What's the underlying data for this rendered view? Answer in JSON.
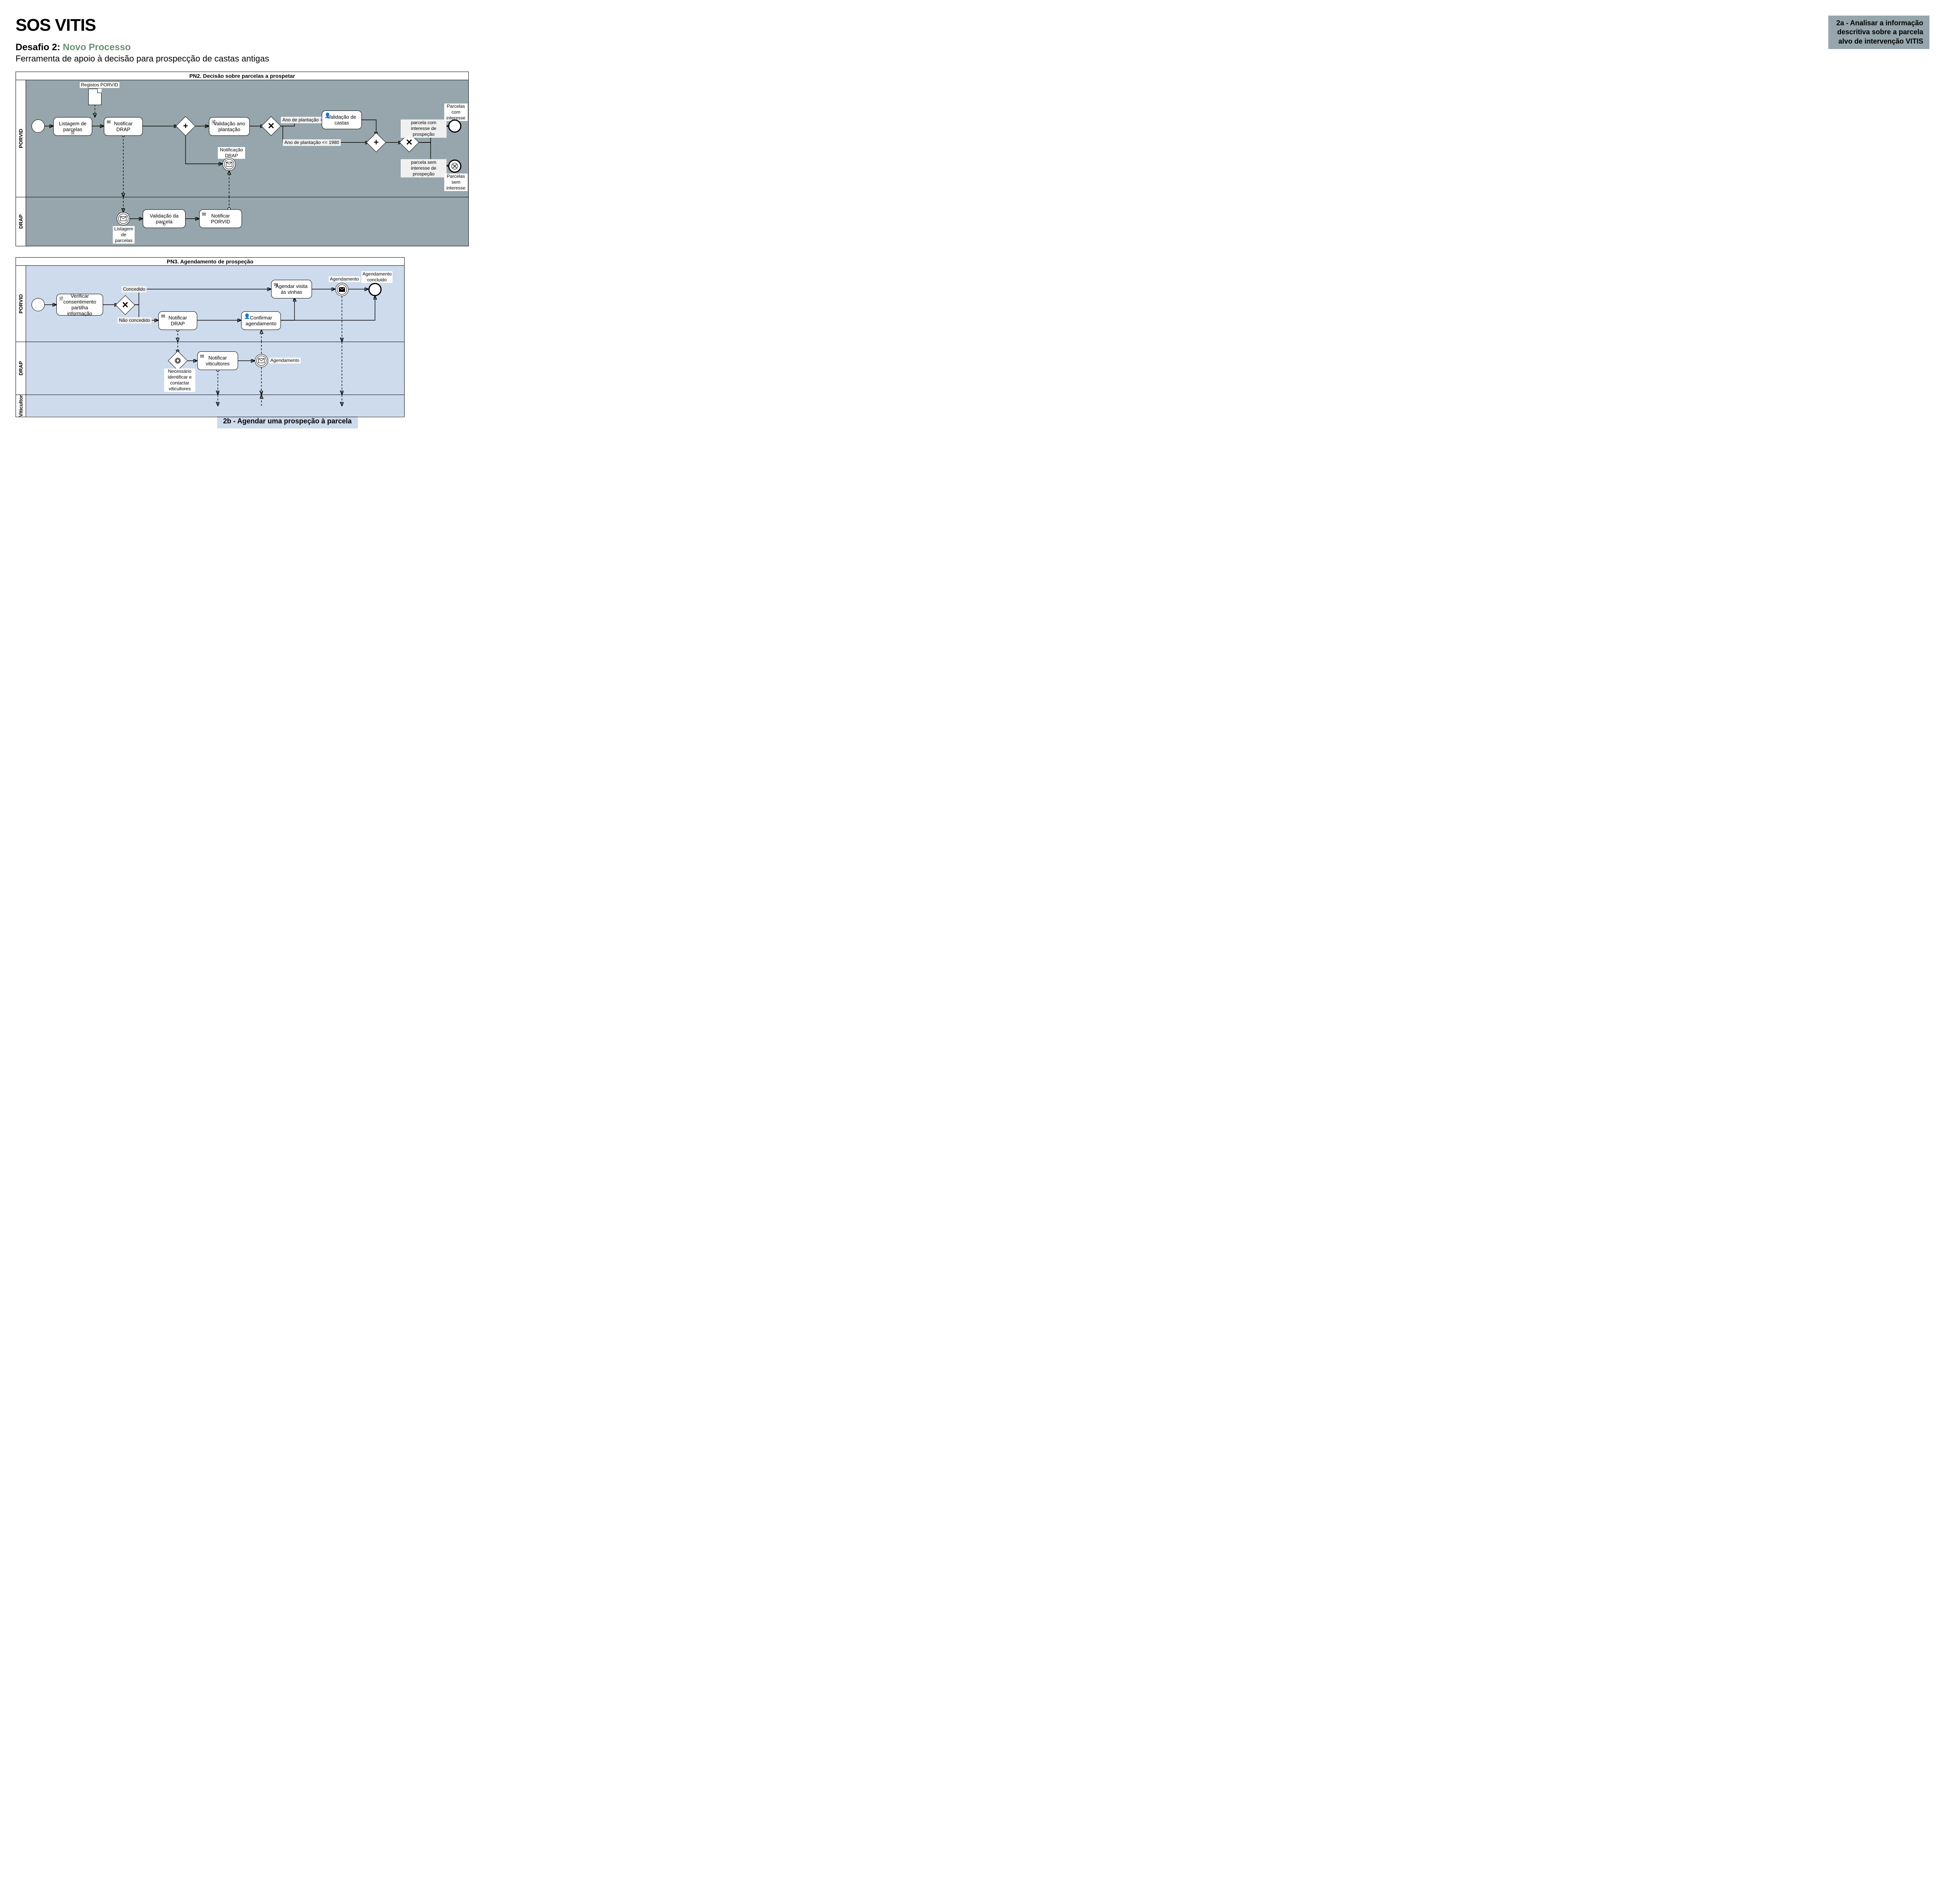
{
  "title": "SOS VITIS",
  "subtitle_prefix": "Desafio 2:",
  "subtitle_green": "Novo Processo",
  "description": "Ferramenta de apoio à decisão para prospecção de castas antigas",
  "note_2a": "2a - Analisar a informação descritiva sobre a parcela alvo de intervenção VITIS",
  "note_2b": "2b - Agendar uma prospeção à parcela",
  "pn2": {
    "title": "PN2. Decisão sobre parcelas a prospetar",
    "lanes": {
      "porvid": "PORVID",
      "drap": "DRAP"
    },
    "data_objects": {
      "registos": "Registos PORVID"
    },
    "tasks": {
      "listagem": "Listagem de parcelas",
      "notificar_drap": "Notificar DRAP",
      "validacao_ano": "Validação ano plantação",
      "validacao_castas": "Validação de castas",
      "validacao_parcela": "Validação da parcela",
      "notificar_porvid": "Notificar PORVID"
    },
    "events": {
      "notificacao_drap": "Notificação DRAP",
      "listagem_parcelas": "Listagem de parcelas",
      "parcelas_com_interesse": "Parcelas com interesse",
      "parcelas_sem_interesse": "Parcelas sem interesse"
    },
    "labels": {
      "gt1980": "Ano de plantação > 1980",
      "lte1980": "Ano de plantação <= 1980",
      "com_interesse": "parcela com interesse de prospeção",
      "sem_interesse": "parcela sem interesse de prospeção"
    }
  },
  "pn3": {
    "title": "PN3. Agendamento de prospeção",
    "lanes": {
      "porvid": "PORVID",
      "drap": "DRAP",
      "viticultor": "Viticultor"
    },
    "tasks": {
      "verificar": "Verificar consentimento partilha informação",
      "notificar_drap": "Notificar DRAP",
      "agendar": "Agendar visita às vinhas",
      "confirmar": "Confirmar agendamento",
      "notificar_viticultores": "Notificar viticultores"
    },
    "events": {
      "necessario": "Necessário identificar e contactar viticultores",
      "agendamento_intermed": "Agendamento",
      "agendamento_throw": "Agendamento",
      "concluido": "Agendamento concluido"
    },
    "labels": {
      "concedido": "Concedido",
      "nao_concedido": "Não concedido"
    }
  }
}
